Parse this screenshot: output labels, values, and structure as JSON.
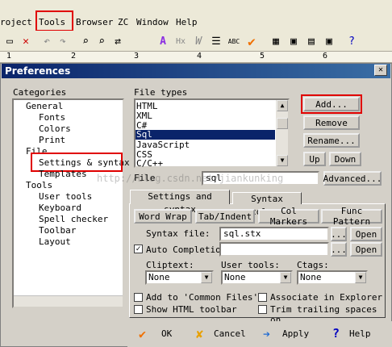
{
  "menubar": {
    "items": [
      "roject",
      "Tools",
      "Browser",
      "ZC",
      "Window",
      "Help"
    ]
  },
  "toolbar": {
    "icons": [
      "copy-icon",
      "close-icon",
      "undo-icon",
      "redo-icon",
      "find-icon",
      "find-in-files-icon",
      "replace-icon",
      "font-icon",
      "hex-icon",
      "word-wrap-icon",
      "list-icon",
      "spell-check-icon",
      "checkmark-icon",
      "tile-icon",
      "window-icon",
      "document-icon",
      "help-icon"
    ]
  },
  "ruler": {
    "marks": [
      "1",
      "2",
      "3",
      "4",
      "5",
      "6"
    ]
  },
  "dialog": {
    "title": "Preferences",
    "categories_label": "Categories",
    "categories": [
      {
        "label": "General",
        "indent": 1
      },
      {
        "label": "Fonts",
        "indent": 2
      },
      {
        "label": "Colors",
        "indent": 2
      },
      {
        "label": "Print",
        "indent": 2
      },
      {
        "label": "File",
        "indent": 1
      },
      {
        "label": "Settings & syntax",
        "indent": 2,
        "selected": true
      },
      {
        "label": "Templates",
        "indent": 2
      },
      {
        "label": "Tools",
        "indent": 1
      },
      {
        "label": "User tools",
        "indent": 2
      },
      {
        "label": "Keyboard",
        "indent": 2
      },
      {
        "label": "Spell checker",
        "indent": 2
      },
      {
        "label": "Toolbar",
        "indent": 2
      },
      {
        "label": "Layout",
        "indent": 2
      }
    ],
    "file_types_label": "File types",
    "file_types": [
      "HTML",
      "XML",
      "C#",
      "Sql",
      "JavaScript",
      "CSS",
      "C/C++"
    ],
    "file_types_selected": "Sql",
    "buttons": {
      "add": "Add...",
      "remove": "Remove",
      "rename": "Rename...",
      "up": "Up",
      "down": "Down",
      "advanced": "Advanced..."
    },
    "file_label": "File",
    "file_value": "sql",
    "watermark": "http://blog.csdn.net/jiankunking",
    "tabs": [
      "Settings and syntax",
      "Syntax colors"
    ],
    "subbuttons": [
      "Word Wrap",
      "Tab/Indent",
      "Col Markers",
      "Func Pattern"
    ],
    "syntax_file_label": "Syntax file:",
    "syntax_file_value": "sql.stx",
    "auto_completion_label": "Auto Completion",
    "auto_completion_checked": true,
    "browse_label": "...",
    "open_label": "Open",
    "cliptext_label": "Cliptext:",
    "user_tools_label": "User tools:",
    "ctags_label": "Ctags:",
    "none_value": "None",
    "checkboxes": {
      "add_common": "Add to 'Common Files'",
      "show_html": "Show HTML toolbar",
      "associate": "Associate in Explorer",
      "trim": "Trim trailing spaces on"
    },
    "footer": {
      "ok": "OK",
      "cancel": "Cancel",
      "apply": "Apply",
      "help": "Help"
    }
  },
  "colors": {
    "highlight": "#e00000",
    "selection": "#0a246a",
    "dialog_bg": "#d4d0c8"
  }
}
